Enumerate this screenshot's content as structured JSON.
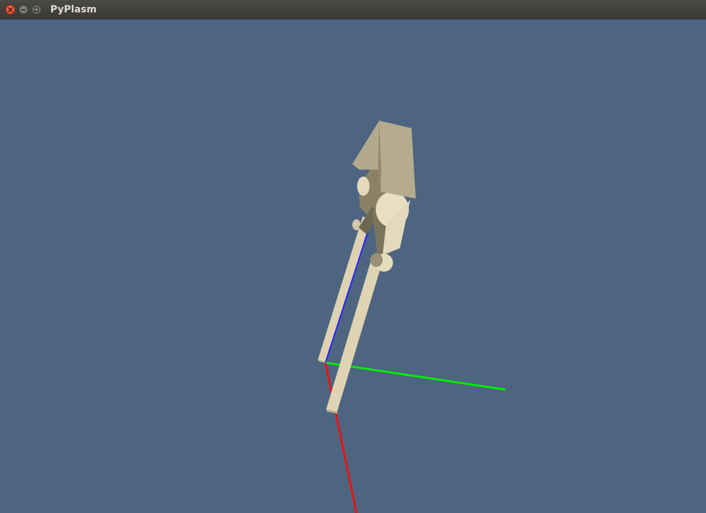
{
  "window": {
    "title": "PyPlasm",
    "buttons": {
      "close": "close-icon",
      "minimize": "minimize-icon",
      "maximize": "maximize-icon"
    }
  },
  "viewport": {
    "background": "#4d6580",
    "axes": {
      "x_color": "#ff0000",
      "y_color": "#00ff00",
      "z_color": "#0000ff"
    },
    "model_color": "#e6dcbe"
  }
}
